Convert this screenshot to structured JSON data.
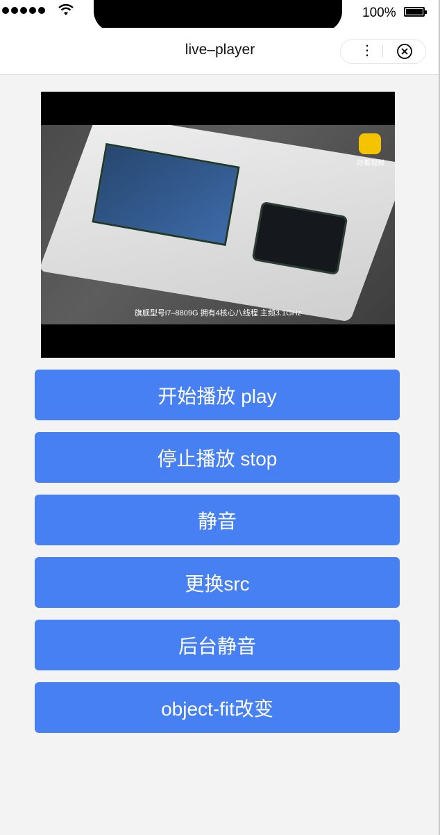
{
  "status_bar": {
    "battery": "100%"
  },
  "nav": {
    "title": "live–player"
  },
  "video": {
    "watermark": "好看视频",
    "subtitle": "旗舰型号i7–8809G  拥有4核心八线程 主频3.1GHz"
  },
  "buttons": {
    "play": "开始播放 play",
    "stop": "停止播放 stop",
    "mute": "静音",
    "change_src": "更换src",
    "bg_mute": "后台静音",
    "object_fit": "object-fit改变"
  },
  "colors": {
    "button": "#4680f2",
    "background": "#f3f3f3"
  }
}
